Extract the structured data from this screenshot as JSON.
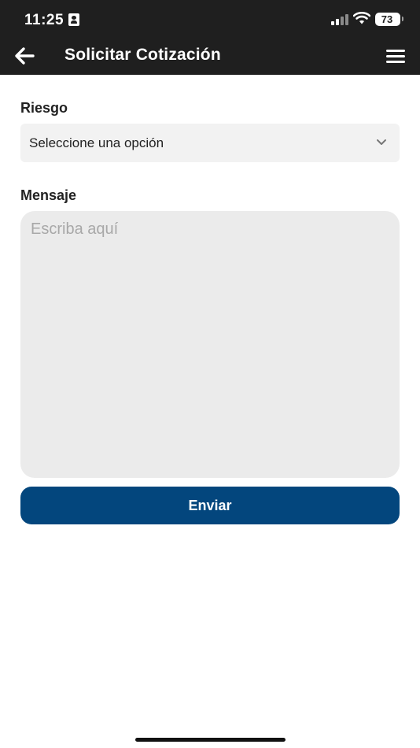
{
  "status_bar": {
    "time": "11:25",
    "battery_level": "73",
    "icons": [
      "id-card-icon",
      "signal-icon",
      "wifi-icon",
      "battery-icon"
    ]
  },
  "header": {
    "title": "Solicitar Cotización",
    "back_icon": "arrow-left-icon",
    "menu_icon": "hamburger-menu-icon"
  },
  "form": {
    "risk_label": "Riesgo",
    "risk_select_value": "Seleccione una opción",
    "message_label": "Mensaje",
    "message_value": "",
    "message_placeholder": "Escriba aquí",
    "submit_label": "Enviar"
  },
  "colors": {
    "header_background": "#1f1f1f",
    "primary_button": "#03467d",
    "select_background": "#f2f2f2",
    "textarea_background": "#ebebeb",
    "placeholder_text": "#a8a8a8"
  }
}
